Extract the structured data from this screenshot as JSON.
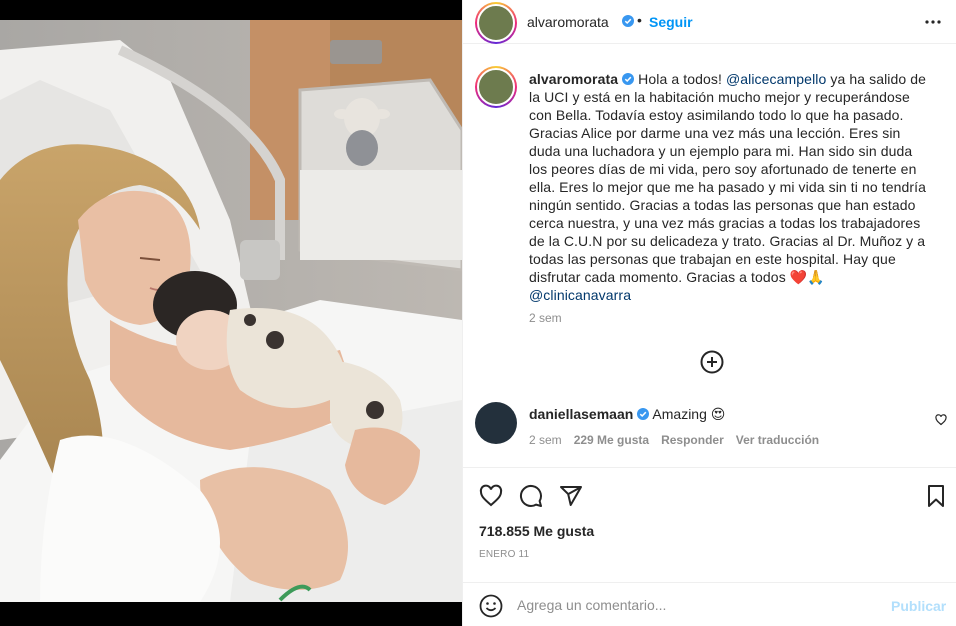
{
  "post": {
    "username": "alvaromorata",
    "separator": "•",
    "follow_label": "Seguir"
  },
  "caption": {
    "username": "alvaromorata",
    "part1": "Hola a todos! ",
    "mention1": "@alicecampello",
    "part2": " ya ha salido de\nla UCI y está en la habitación mucho mejor y recuperándose\ncon Bella. Todavía estoy asimilando todo lo que ha pasado.\nGracias Alice por darme una vez más una lección. Eres sin\nduda una luchadora y un ejemplo para mi. Han sido sin duda\nlos peores días de mi vida, pero soy afortunado de tenerte en\nella. Eres lo mejor que me ha pasado y mi vida sin ti no tendría\nningún sentido. Gracias a todas las personas que han estado\ncerca nuestra, y una vez más gracias a todas los trabajadores\nde la C.U.N por su delicadeza y trato. Gracias al Dr. Muñoz y a\ntodas las personas que trabajan en este hospital. Hay que\ndisfrutar cada momento. Gracias a todos ❤️🙏\n",
    "mention2": "@clinicanavarra",
    "time": "2 sem"
  },
  "comment": {
    "username": "daniellasemaan",
    "text": "Amazing 😍",
    "time": "2 sem",
    "likes": "229 Me gusta",
    "reply_label": "Responder",
    "translate_label": "Ver traducción"
  },
  "stats": {
    "likes": "718.855 Me gusta",
    "date": "ENERO 11"
  },
  "add_comment": {
    "placeholder": "Agrega un comentario...",
    "publish_label": "Publicar"
  },
  "colors": {
    "link_blue": "#0095f6",
    "mention_blue": "#00376b",
    "verified_blue": "#3897f0",
    "muted_gray": "#8e8e8e",
    "publish_disabled": "#b2dffc"
  },
  "icons": {
    "header_more": "more-horizontal-icon",
    "load_more": "plus-circle-icon",
    "comment_like": "heart-icon",
    "like": "heart-icon",
    "comment": "comment-icon",
    "share": "send-icon",
    "save": "bookmark-icon",
    "emoji": "emoji-icon",
    "verified": "verified-badge-icon"
  }
}
